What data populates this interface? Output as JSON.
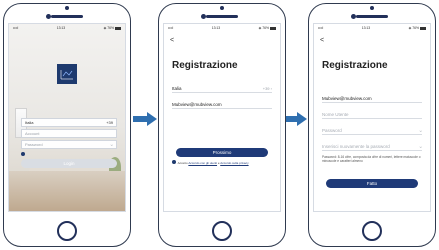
{
  "status_bar": {
    "signal": "•••ıl",
    "wifi": "≈",
    "time": "13:13",
    "battery_pct": "◈ 76%"
  },
  "colors": {
    "brand": "#1f3a78",
    "arrow": "#2f6fb0",
    "frame": "#2f3a4f"
  },
  "screen1": {
    "country_label": "Italia",
    "country_code": "+39",
    "account_placeholder": "Account",
    "password_placeholder": "Password",
    "eye_icon": "eye-icon",
    "helper_left": "",
    "helper_right": "",
    "login_label": "Login",
    "register_text": ""
  },
  "screen2": {
    "back": "<",
    "title": "Registrazione",
    "country_label": "Italia",
    "country_code": "+39",
    "email_value": "Mubview@mubview.com",
    "button_label": "Prossimo",
    "consent_prefix": "Accetto",
    "consent_link1": "Accordo con gli utenti",
    "consent_and": "e",
    "consent_link2": "Accordo sulla privacy"
  },
  "screen3": {
    "back": "<",
    "title": "Registrazione",
    "email_value": "Mubview@mubview.com",
    "nickname_placeholder": "Nome Utente",
    "password_placeholder": "Password",
    "confirm_placeholder": "Inserisci nuovamente la password",
    "hint": "Password: 8-16 cifre, composta da cifre di numeri, lettere maiuscole o minuscole e caratteri almeno",
    "button_label": "Fatto"
  }
}
